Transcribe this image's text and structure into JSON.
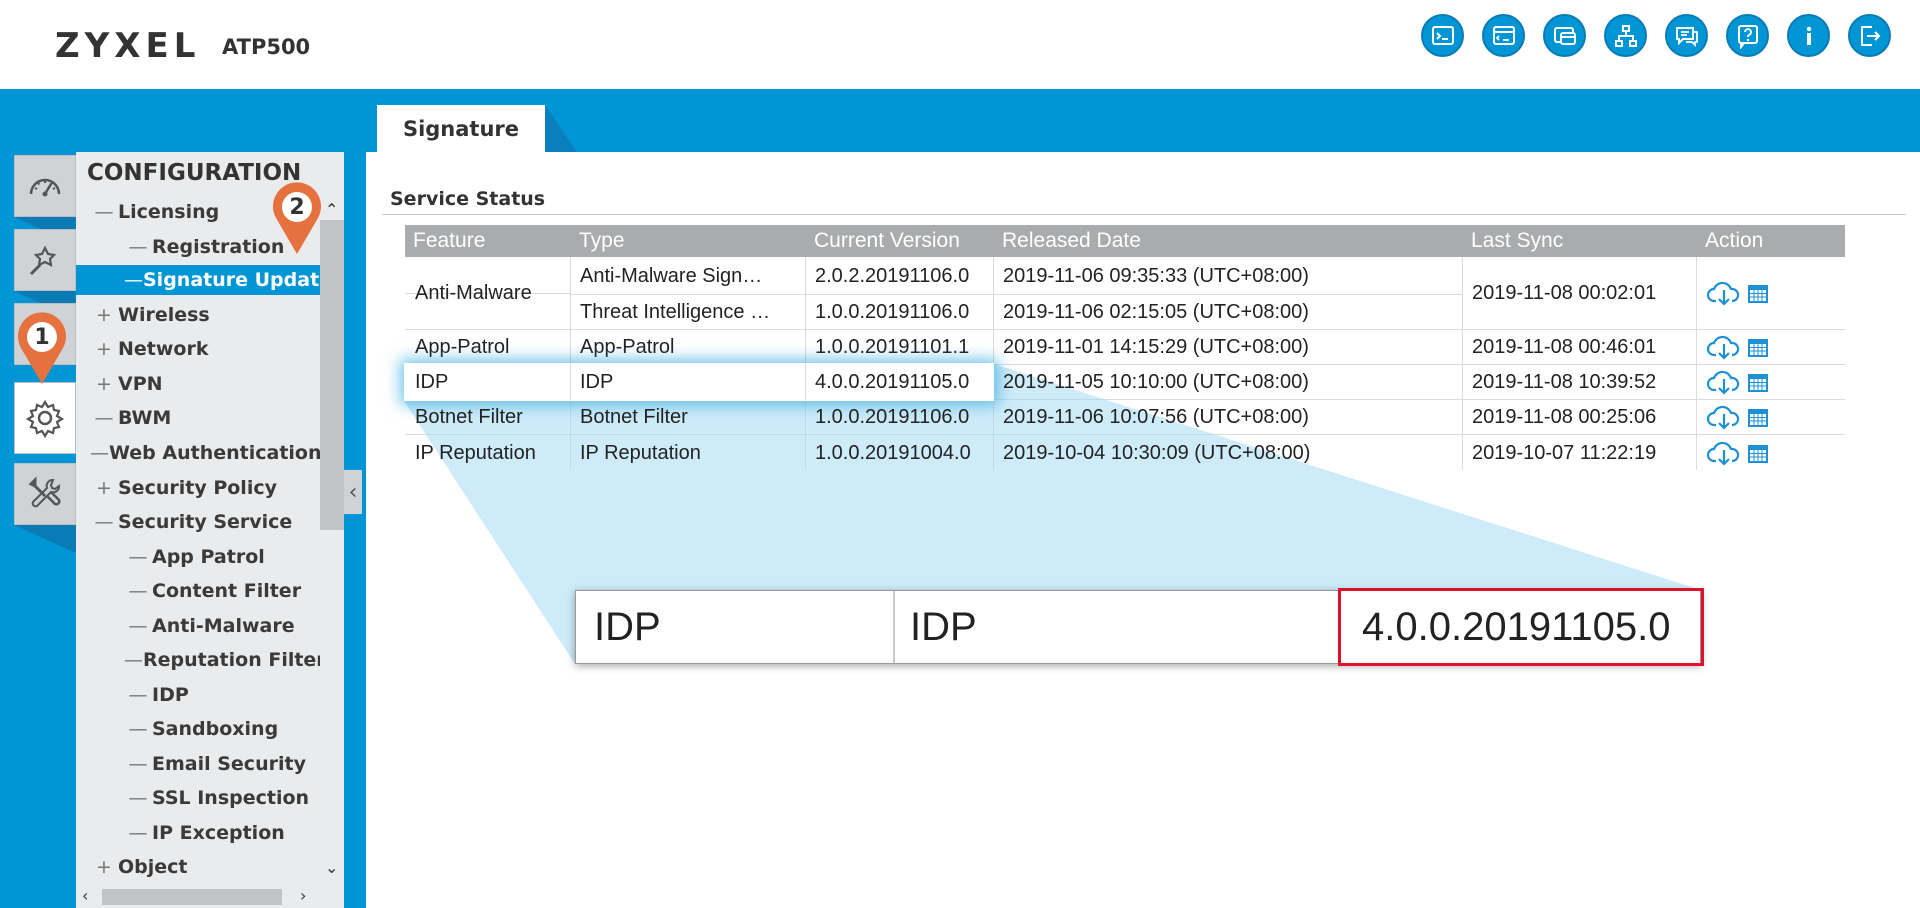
{
  "header": {
    "brand": "ZYXEL",
    "model": "ATP500",
    "icons": [
      "console-icon",
      "cli-icon",
      "window-icon",
      "sitemap-icon",
      "chat-icon",
      "help-icon",
      "info-icon",
      "logout-icon"
    ]
  },
  "tab": {
    "label": "Signature"
  },
  "markers": {
    "one": "1",
    "two": "2"
  },
  "menu": {
    "title": "CONFIGURATION",
    "items": [
      {
        "sym": "—",
        "label": "Licensing",
        "level": 1
      },
      {
        "sym": "—",
        "label": "Registration",
        "level": 2
      },
      {
        "sym": "—",
        "label": "Signature Update",
        "level": 2,
        "selected": true
      },
      {
        "sym": "+",
        "label": "Wireless",
        "level": 1
      },
      {
        "sym": "+",
        "label": "Network",
        "level": 1
      },
      {
        "sym": "+",
        "label": "VPN",
        "level": 1
      },
      {
        "sym": "—",
        "label": "BWM",
        "level": 1
      },
      {
        "sym": "—",
        "label": "Web Authentication",
        "level": 1
      },
      {
        "sym": "+",
        "label": "Security Policy",
        "level": 1
      },
      {
        "sym": "—",
        "label": "Security Service",
        "level": 1
      },
      {
        "sym": "—",
        "label": "App Patrol",
        "level": 2
      },
      {
        "sym": "—",
        "label": "Content Filter",
        "level": 2
      },
      {
        "sym": "—",
        "label": "Anti-Malware",
        "level": 2
      },
      {
        "sym": "—",
        "label": "Reputation Filter",
        "level": 2
      },
      {
        "sym": "—",
        "label": "IDP",
        "level": 2
      },
      {
        "sym": "—",
        "label": "Sandboxing",
        "level": 2
      },
      {
        "sym": "—",
        "label": "Email Security",
        "level": 2
      },
      {
        "sym": "—",
        "label": "SSL Inspection",
        "level": 2
      },
      {
        "sym": "—",
        "label": "IP Exception",
        "level": 2
      },
      {
        "sym": "+",
        "label": "Object",
        "level": 1
      }
    ]
  },
  "service_status": {
    "title": "Service Status",
    "columns": [
      "Feature",
      "Type",
      "Current Version",
      "Released Date",
      "Last Sync",
      "Action"
    ],
    "rows": [
      {
        "feature": "Anti-Malware",
        "type": "Anti-Malware Sign…",
        "version": "2.0.2.20191106.0",
        "released": "2019-11-06 09:35:33 (UTC+08:00)",
        "sync": "2019-11-08 00:02:01"
      },
      {
        "feature": "",
        "type": "Threat Intelligence …",
        "version": "1.0.0.20191106.0",
        "released": "2019-11-06 02:15:05 (UTC+08:00)",
        "sync": ""
      },
      {
        "feature": "App-Patrol",
        "type": "App-Patrol",
        "version": "1.0.0.20191101.1",
        "released": "2019-11-01 14:15:29 (UTC+08:00)",
        "sync": "2019-11-08 00:46:01"
      },
      {
        "feature": "IDP",
        "type": "IDP",
        "version": "4.0.0.20191105.0",
        "released": "2019-11-05 10:10:00 (UTC+08:00)",
        "sync": "2019-11-08 10:39:52"
      },
      {
        "feature": "Botnet Filter",
        "type": "Botnet Filter",
        "version": "1.0.0.20191106.0",
        "released": "2019-11-06 10:07:56 (UTC+08:00)",
        "sync": "2019-11-08 00:25:06"
      },
      {
        "feature": "IP Reputation",
        "type": "IP Reputation",
        "version": "1.0.0.20191004.0",
        "released": "2019-10-04 10:30:09 (UTC+08:00)",
        "sync": "2019-10-07 11:22:19"
      }
    ]
  },
  "zoom": {
    "feature": "IDP",
    "type": "IDP",
    "version": "4.0.0.20191105.0"
  },
  "colors": {
    "accent": "#0096d6",
    "marker": "#e5713f",
    "highlight_border": "#e0112b",
    "header_row": "#a9abad"
  }
}
